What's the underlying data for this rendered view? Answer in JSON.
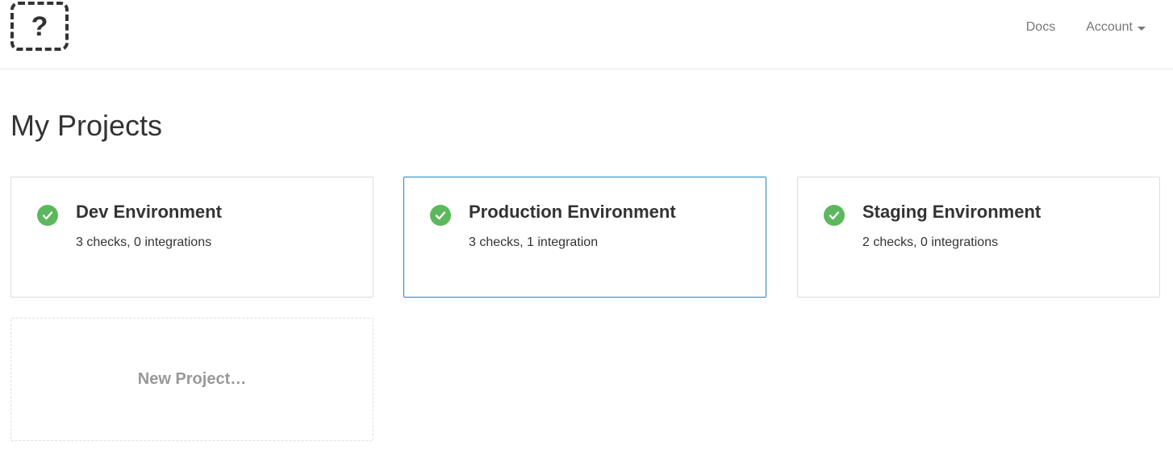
{
  "header": {
    "logo_glyph": "?",
    "nav": {
      "docs_label": "Docs",
      "account_label": "Account"
    }
  },
  "main": {
    "title": "My Projects",
    "projects": [
      {
        "name": "Dev Environment",
        "meta": "3 checks, 0 integrations",
        "status": "ok",
        "selected": false
      },
      {
        "name": "Production Environment",
        "meta": "3 checks, 1 integration",
        "status": "ok",
        "selected": true
      },
      {
        "name": "Staging Environment",
        "meta": "2 checks, 0 integrations",
        "status": "ok",
        "selected": false
      }
    ],
    "new_project_label": "New Project…"
  },
  "colors": {
    "status_ok": "#5cb85c",
    "selected_border": "#1e88c7",
    "card_border": "#dddddd",
    "muted_text": "#999999",
    "nav_text": "#777777"
  },
  "icons": {
    "status": "check-circle-icon",
    "logo": "question-mark-logo-icon",
    "account_dropdown": "caret-down-icon"
  }
}
